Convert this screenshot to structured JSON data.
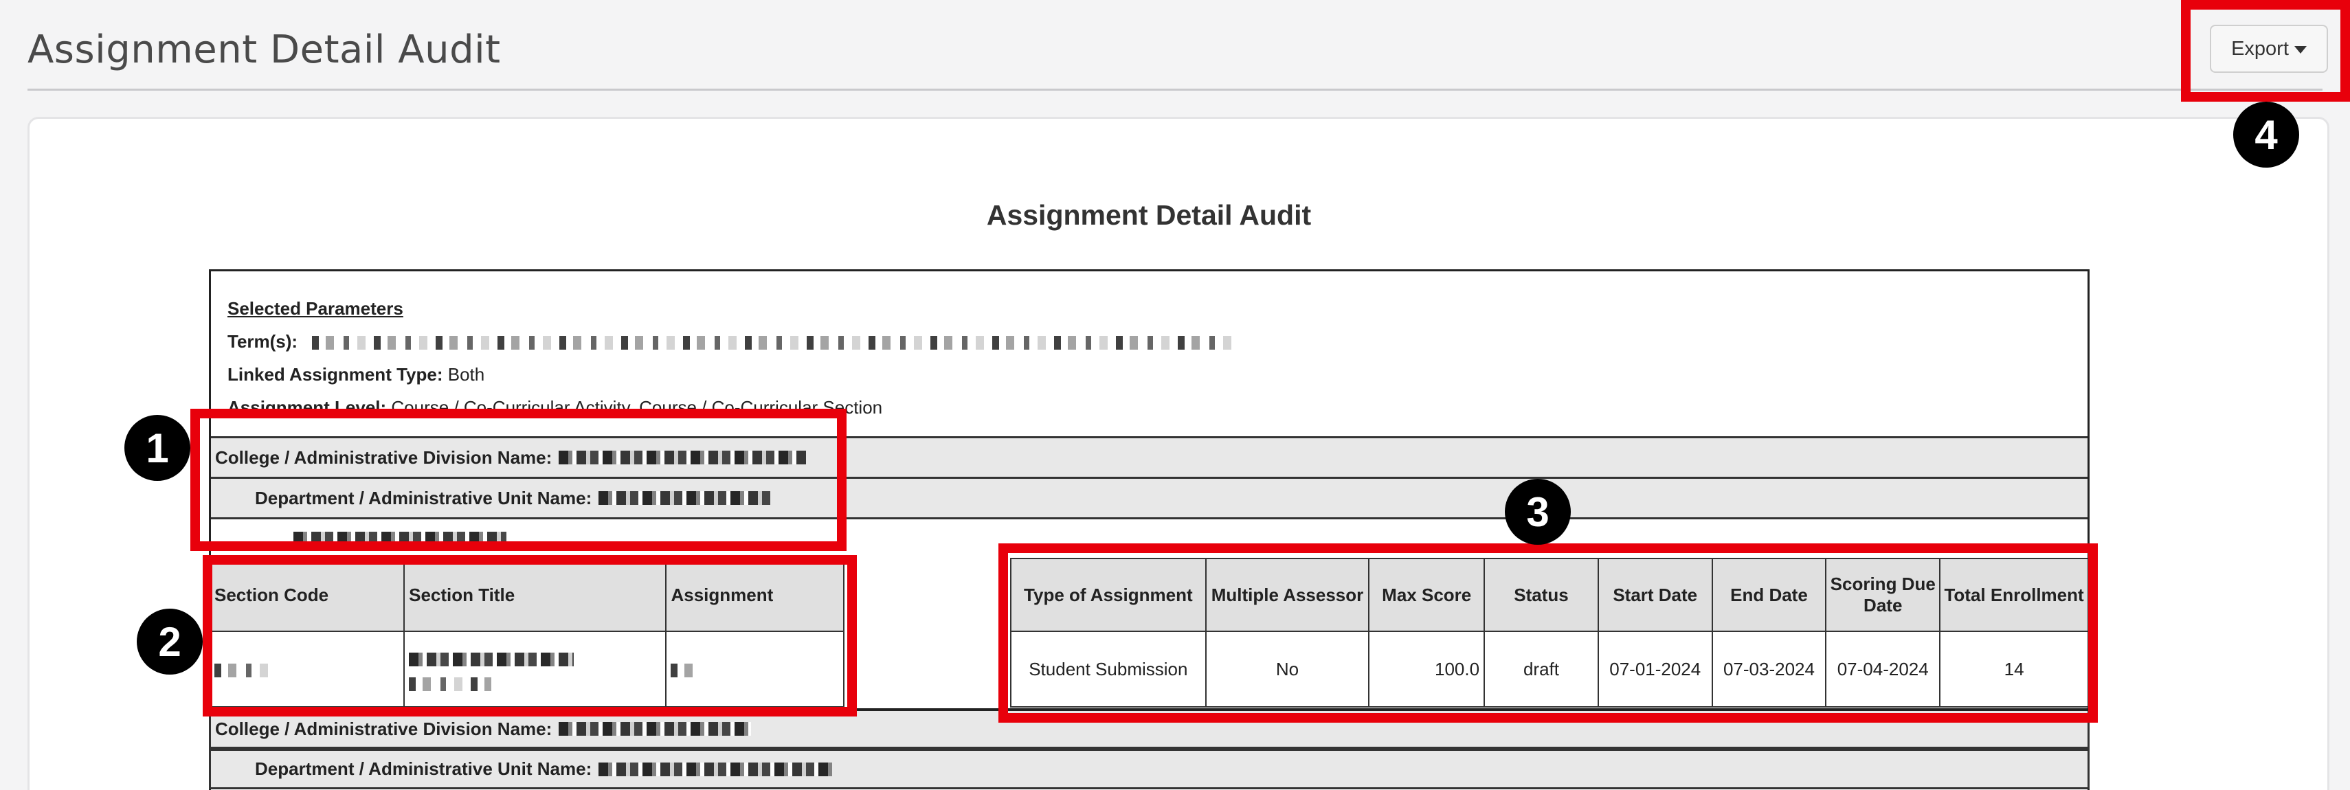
{
  "header": {
    "title": "Assignment Detail Audit",
    "export_label": "Export"
  },
  "report": {
    "title": "Assignment Detail Audit",
    "params": {
      "heading": "Selected Parameters",
      "term_label": "Term(s):",
      "linked_type_label": "Linked Assignment Type:",
      "linked_type_value": "Both",
      "level_label": "Assignment Level:",
      "level_value": "Course / Co-Curricular Activity, Course / Co-Curricular Section"
    },
    "college_label": "College / Administrative Division Name:",
    "department_label": "Department / Administrative Unit Name:",
    "section_table": {
      "headers": [
        "Section Code",
        "Section Title",
        "Assignment"
      ]
    },
    "detail_table": {
      "headers": [
        "Type of Assignment",
        "Multiple Assessor",
        "Max Score",
        "Status",
        "Start Date",
        "End Date",
        "Scoring Due Date",
        "Total Enrollment"
      ],
      "rows": [
        [
          "Student Submission",
          "No",
          "100.0",
          "draft",
          "07-01-2024",
          "07-03-2024",
          "07-04-2024",
          "14"
        ]
      ]
    }
  },
  "annotations": {
    "badges": [
      "1",
      "2",
      "3",
      "4"
    ],
    "highlight_color": "#e8000b"
  }
}
